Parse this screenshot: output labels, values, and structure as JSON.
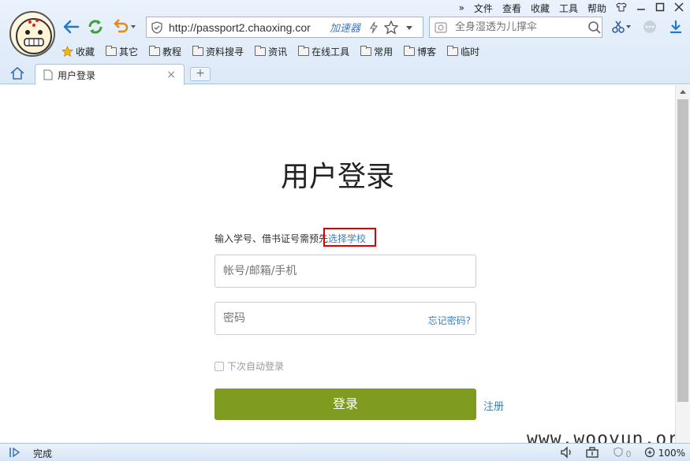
{
  "browser": {
    "menu": [
      "文件",
      "查看",
      "收藏",
      "工具",
      "帮助"
    ],
    "address": "http://passport2.chaoxing.cor",
    "accelerator_label": "加速器",
    "search_placeholder": "全身湿透为儿撑伞",
    "bookmarks": [
      "收藏",
      "其它",
      "教程",
      "资料搜寻",
      "资讯",
      "在线工具",
      "常用",
      "博客",
      "临时"
    ],
    "tab_title": "用户登录",
    "status_text": "完成",
    "zoom": "100%",
    "counter": "0"
  },
  "page": {
    "title": "用户登录",
    "hint_text": "输入学号、借书证号需预先",
    "hint_link": "选择学校",
    "account_placeholder": "帐号/邮箱/手机",
    "password_placeholder": "密码",
    "forgot_label": "忘记密码?",
    "remember_label": "下次自动登录",
    "login_label": "登录",
    "register_label": "注册",
    "watermark": "www.wooyun.org"
  },
  "colors": {
    "login_button": "#7f9b20",
    "link": "#3b7fc4",
    "highlight_box": "#e00000"
  }
}
